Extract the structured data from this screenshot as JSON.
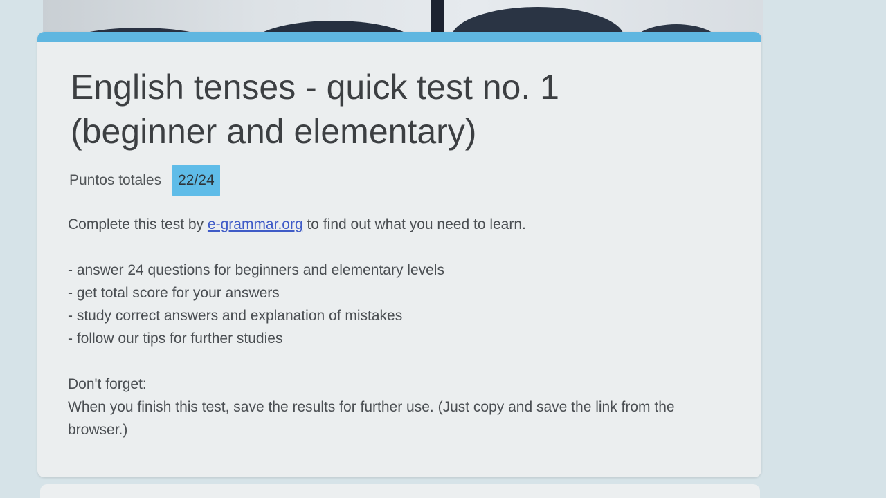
{
  "form": {
    "title_line1": "English tenses - quick test no. 1",
    "title_line2": "(beginner and elementary)",
    "points_label": "Puntos totales",
    "score": "22/24",
    "intro_prefix": "Complete this test by ",
    "intro_link": "e-grammar.org",
    "intro_suffix": " to find out what you need to learn.",
    "bullets": [
      "- answer 24 questions for beginners and elementary levels",
      "- get total score for your answers",
      "- study correct answers and explanation of mistakes",
      "- follow our tips for further studies"
    ],
    "reminder_heading": "Don't forget:",
    "reminder_text": "When you finish this test, save the results for further use. (Just copy and save the link from the browser.)"
  },
  "colors": {
    "accent": "#5fb6e0",
    "badge": "#5fbce8",
    "link": "#3f5bc7",
    "page_background": "#d6e3e8",
    "card_background": "#ebeeef"
  }
}
